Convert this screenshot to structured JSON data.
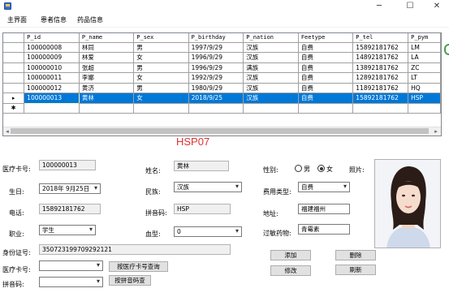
{
  "window": {
    "minimize": "─",
    "maximize": "☐",
    "close": "✕"
  },
  "menu": [
    "主界面",
    "患者信息",
    "药品信息"
  ],
  "grid": {
    "columns": [
      "P_id",
      "P_name",
      "P_sex",
      "P_birthday",
      "P_nation",
      "Feetype",
      "P_tel",
      "P_pym"
    ],
    "rows": [
      [
        "100000008",
        "林同",
        "男",
        "1997/9/29",
        "汉族",
        "自费",
        "15892181762",
        "LM"
      ],
      [
        "100000009",
        "林爱",
        "女",
        "1996/9/29",
        "汉族",
        "自费",
        "14892181762",
        "LA"
      ],
      [
        "100000010",
        "张超",
        "男",
        "1996/9/29",
        "满族",
        "自费",
        "13892181762",
        "ZC"
      ],
      [
        "100000011",
        "李娜",
        "女",
        "1992/9/29",
        "汉族",
        "自费",
        "12892181762",
        "LT"
      ],
      [
        "100000012",
        "黄济",
        "男",
        "1980/9/29",
        "汉族",
        "自费",
        "11892181762",
        "HQ"
      ],
      [
        "100000013",
        "黄林",
        "女",
        "2018/9/25",
        "汉族",
        "自费",
        "15892181762",
        "HSP"
      ]
    ],
    "current_marker": "▸",
    "new_row_marker": "✱",
    "scroll_left": "◂",
    "scroll_right": "▸"
  },
  "heading": "HSP07",
  "form": {
    "card_label": "医疗卡号:",
    "card_value": "100000013",
    "name_label": "姓名:",
    "name_value": "黄林",
    "sex_label": "性别:",
    "sex_male": "男",
    "sex_female": "女",
    "photo_label": "照片:",
    "birth_label": "生日:",
    "birth_value": "2018年 9月25日",
    "nation_label": "民族:",
    "nation_value": "汉族",
    "feetype_label": "费用类型:",
    "feetype_value": "自费",
    "tel_label": "电话:",
    "tel_value": "15892181762",
    "pym_label": "拼音码:",
    "pym_value": "HSP",
    "addr_label": "地址:",
    "addr_value": "福建福州",
    "job_label": "职业:",
    "job_value": "学生",
    "blood_label": "血型:",
    "blood_value": "0",
    "allergy_label": "过敏药物:",
    "allergy_value": "青霉素",
    "id_label": "身份证号:",
    "id_value": "350723199709292121",
    "add_btn": "添加",
    "delete_btn": "删除",
    "edit_btn": "修改",
    "refresh_btn": "刷新",
    "search_card_label": "医疗卡号:",
    "search_card_btn": "按医疗卡号查询",
    "search_pym_label": "拼音码:",
    "search_pym_btn": "按拼音码查"
  },
  "colors": {
    "selection": "#0078d7",
    "heading": "#e03030"
  }
}
